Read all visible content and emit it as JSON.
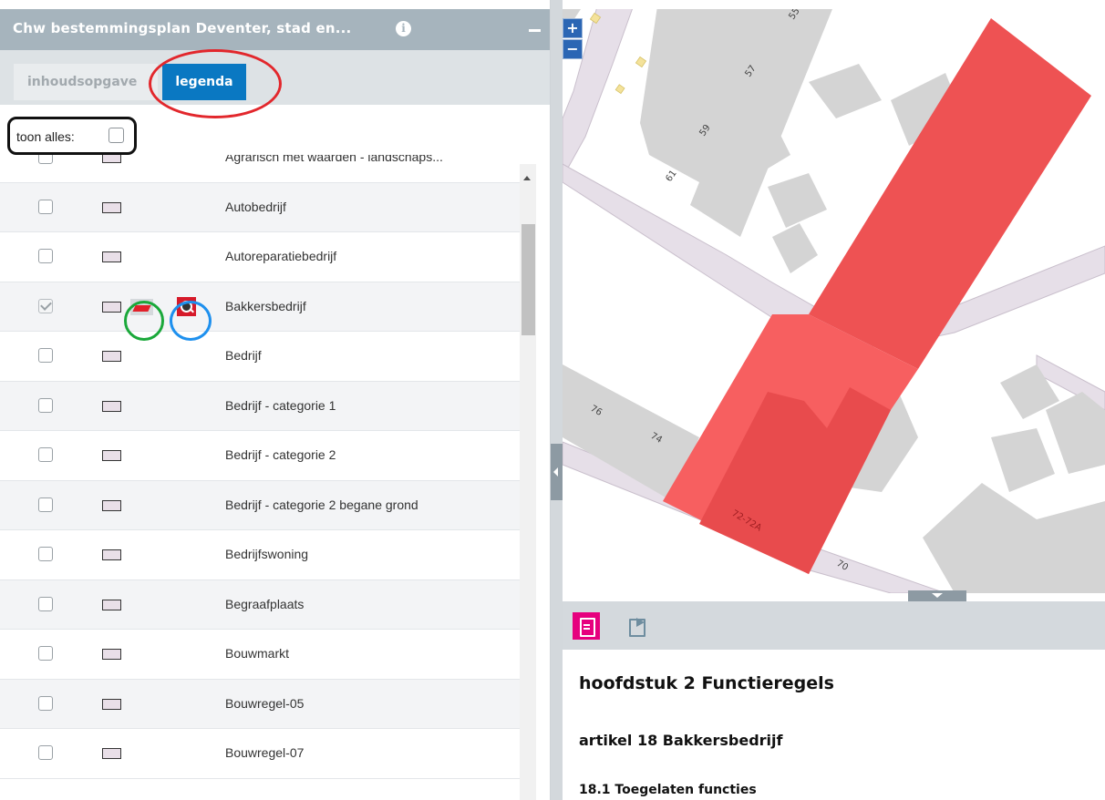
{
  "panel": {
    "title": "Chw bestemmingsplan Deventer, stad en...",
    "info_icon": "info-icon",
    "collapse_icon": "minus-icon"
  },
  "tabs": [
    {
      "label": "inhoudsopgave",
      "active": false
    },
    {
      "label": "legenda",
      "active": true
    }
  ],
  "toon_alles": {
    "label": "toon alles:",
    "checked": false
  },
  "legend": {
    "items": [
      {
        "label": "Agrarisch met waarden - landschaps...",
        "checked": false
      },
      {
        "label": "Autobedrijf",
        "checked": false
      },
      {
        "label": "Autoreparatiebedrijf",
        "checked": false
      },
      {
        "label": "Bakkersbedrijf",
        "checked": true
      },
      {
        "label": "Bedrijf",
        "checked": false
      },
      {
        "label": "Bedrijf - categorie 1",
        "checked": false
      },
      {
        "label": "Bedrijf - categorie 2",
        "checked": false
      },
      {
        "label": "Bedrijf - categorie 2 begane grond",
        "checked": false
      },
      {
        "label": "Bedrijfswoning",
        "checked": false
      },
      {
        "label": "Begraafplaats",
        "checked": false
      },
      {
        "label": "Bouwmarkt",
        "checked": false
      },
      {
        "label": "Bouwregel-05",
        "checked": false
      },
      {
        "label": "Bouwregel-07",
        "checked": false
      }
    ],
    "swatch_color": "#e9dfe8",
    "active_style_color": "#e2202a",
    "zoom_color": "#d61a2a"
  },
  "map": {
    "zoom_in": "+",
    "zoom_out": "−",
    "house_numbers": [
      "55",
      "57",
      "59",
      "61",
      "76",
      "74",
      "72-72A",
      "70"
    ],
    "highlight_color": "#f04e50"
  },
  "detail": {
    "chapter": "hoofdstuk 2 Functieregels",
    "article": "artikel 18 Bakkersbedrijf",
    "section": "18.1 Toegelaten functies",
    "doc_icon_color": "#e6007e"
  }
}
